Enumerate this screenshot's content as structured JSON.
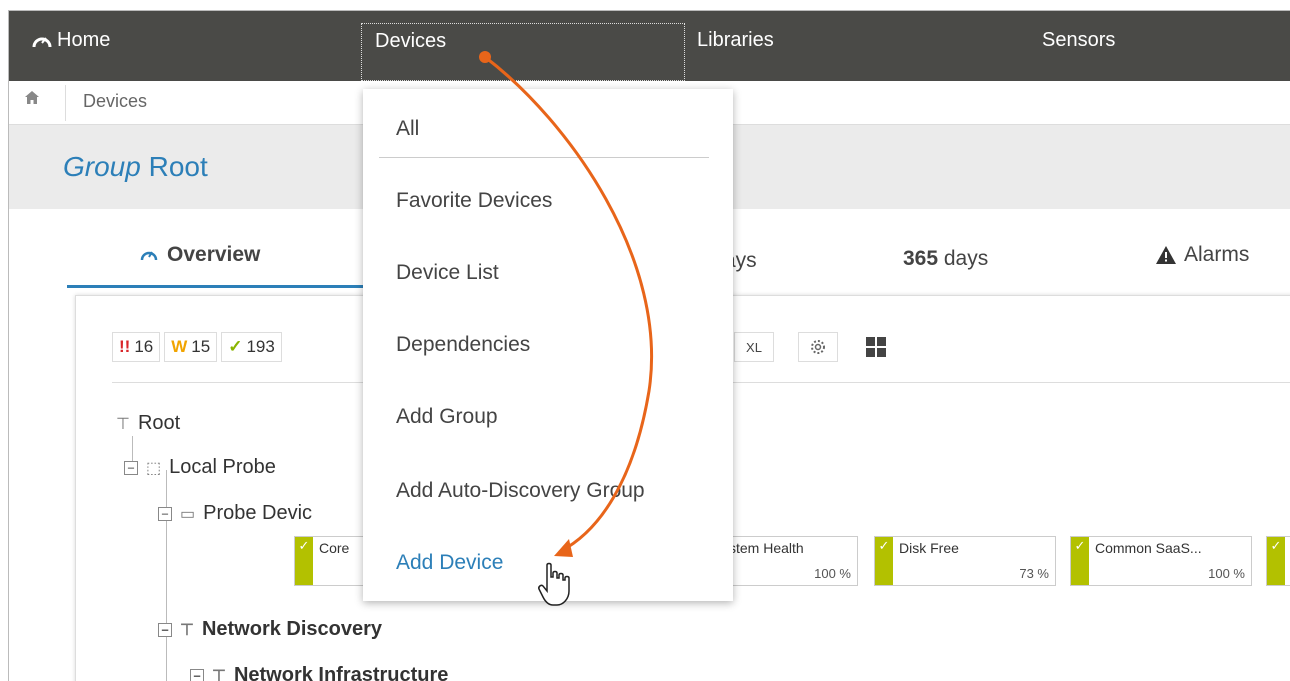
{
  "nav": {
    "home": "Home",
    "devices": "Devices",
    "libraries": "Libraries",
    "sensors": "Sensors"
  },
  "breadcrumb": {
    "label": "Devices"
  },
  "group": {
    "prefix": "Group",
    "name": "Root"
  },
  "tabs": {
    "overview": "Overview",
    "days_30_partial": "ays",
    "days_365_num": "365",
    "days_365_unit": " days",
    "alarms": "Alarms"
  },
  "status": {
    "error_icon": "!!",
    "error_count": "16",
    "warning_icon": "W",
    "warning_count": "15",
    "ok_icon": "✓",
    "ok_count": "193"
  },
  "toolbar": {
    "size_xl": "XL"
  },
  "tree": {
    "root": "Root",
    "local_probe": "Local Probe",
    "probe_device": "Probe Devic",
    "network_discovery": "Network Discovery",
    "network_infrastructure": "Network Infrastructure"
  },
  "sensors": [
    {
      "name": "Core",
      "value": ""
    },
    {
      "name": "stem Health",
      "value": "100 %"
    },
    {
      "name": "Disk Free",
      "value": "73 %"
    },
    {
      "name": "Common SaaS...",
      "value": "100 %"
    }
  ],
  "dropdown": {
    "items": [
      "All",
      "Favorite Devices",
      "Device List",
      "Dependencies",
      "Add Group",
      "Add Auto-Discovery Group",
      "Add Device"
    ]
  },
  "colors": {
    "nav_bg": "#4a4a47",
    "accent_blue": "#2c7fb8",
    "ok_green": "#b3c100",
    "arrow_orange": "#e8651a"
  },
  "icons": {
    "home": "home-gauge-icon",
    "breadcrumb_home": "house-icon",
    "alarm": "warning-triangle-icon",
    "cursor": "hand-pointer-cursor-icon"
  }
}
